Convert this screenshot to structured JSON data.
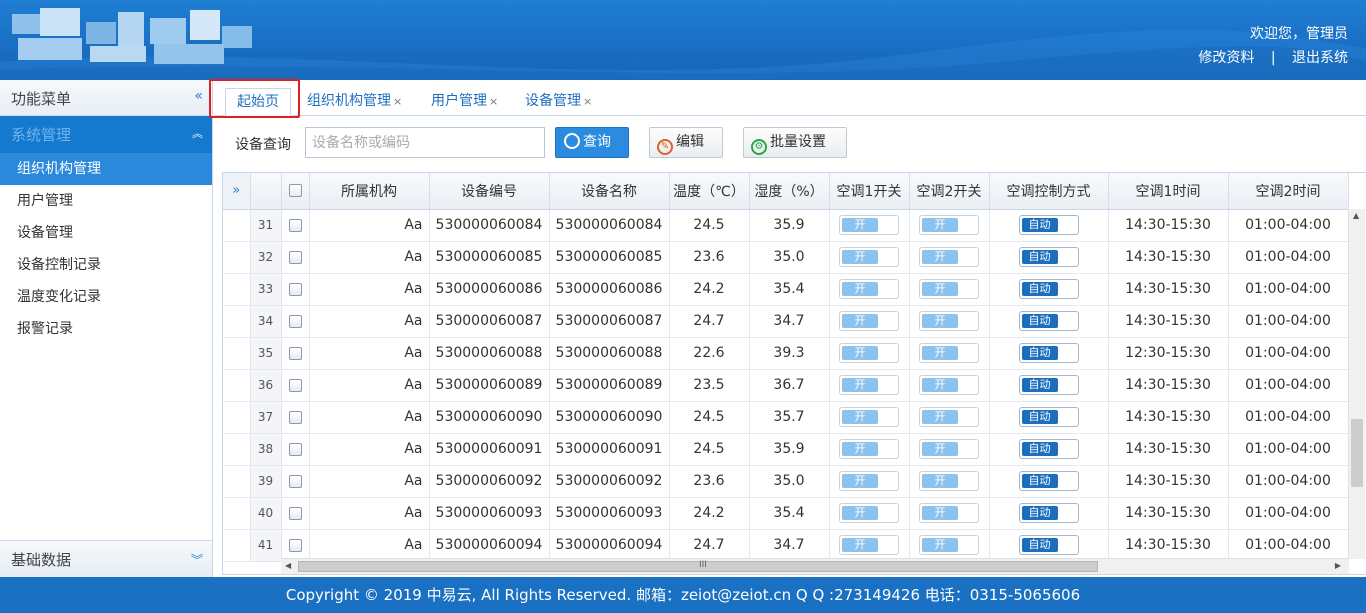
{
  "header": {
    "welcome": "欢迎您，管理员",
    "edit_profile": "修改资料",
    "separator": "|",
    "logout": "退出系统"
  },
  "sidebar": {
    "title": "功能菜单",
    "collapse_icon": "«",
    "group": "系统管理",
    "items": [
      {
        "label": "组织机构管理",
        "active": true
      },
      {
        "label": "用户管理"
      },
      {
        "label": "设备管理"
      },
      {
        "label": "设备控制记录"
      },
      {
        "label": "温度变化记录"
      },
      {
        "label": "报警记录"
      }
    ],
    "footer_group": "基础数据"
  },
  "tabs": [
    {
      "label": "起始页",
      "active": true
    },
    {
      "label": "组织机构管理",
      "close": "×"
    },
    {
      "label": "用户管理",
      "close": "×"
    },
    {
      "label": "设备管理",
      "close": "×"
    }
  ],
  "toolbar": {
    "search_label": "设备查询",
    "search_placeholder": "设备名称或编码",
    "search_value": "",
    "query_button": "查询",
    "edit_button": "编辑",
    "batch_button": "批量设置"
  },
  "grid": {
    "expand_icon": "»",
    "columns": [
      "所属机构",
      "设备编号",
      "设备名称",
      "温度（℃）",
      "湿度（%）",
      "空调1开关",
      "空调2开关",
      "空调控制方式",
      "空调1时间",
      "空调2时间"
    ],
    "switch_on_label": "开",
    "auto_label": "自动",
    "rows": [
      {
        "no": "31",
        "org": "Aa",
        "code": "530000060084",
        "name": "530000060084",
        "temp": "24.5",
        "hum": "35.9",
        "t1": "14:30-15:30",
        "t2": "01:00-04:00"
      },
      {
        "no": "32",
        "org": "Aa",
        "code": "530000060085",
        "name": "530000060085",
        "temp": "23.6",
        "hum": "35.0",
        "t1": "14:30-15:30",
        "t2": "01:00-04:00"
      },
      {
        "no": "33",
        "org": "Aa",
        "code": "530000060086",
        "name": "530000060086",
        "temp": "24.2",
        "hum": "35.4",
        "t1": "14:30-15:30",
        "t2": "01:00-04:00"
      },
      {
        "no": "34",
        "org": "Aa",
        "code": "530000060087",
        "name": "530000060087",
        "temp": "24.7",
        "hum": "34.7",
        "t1": "14:30-15:30",
        "t2": "01:00-04:00"
      },
      {
        "no": "35",
        "org": "Aa",
        "code": "530000060088",
        "name": "530000060088",
        "temp": "22.6",
        "hum": "39.3",
        "t1": "12:30-15:30",
        "t2": "01:00-04:00"
      },
      {
        "no": "36",
        "org": "Aa",
        "code": "530000060089",
        "name": "530000060089",
        "temp": "23.5",
        "hum": "36.7",
        "t1": "14:30-15:30",
        "t2": "01:00-04:00"
      },
      {
        "no": "37",
        "org": "Aa",
        "code": "530000060090",
        "name": "530000060090",
        "temp": "24.5",
        "hum": "35.7",
        "t1": "14:30-15:30",
        "t2": "01:00-04:00"
      },
      {
        "no": "38",
        "org": "Aa",
        "code": "530000060091",
        "name": "530000060091",
        "temp": "24.5",
        "hum": "35.9",
        "t1": "14:30-15:30",
        "t2": "01:00-04:00"
      },
      {
        "no": "39",
        "org": "Aa",
        "code": "530000060092",
        "name": "530000060092",
        "temp": "23.6",
        "hum": "35.0",
        "t1": "14:30-15:30",
        "t2": "01:00-04:00"
      },
      {
        "no": "40",
        "org": "Aa",
        "code": "530000060093",
        "name": "530000060093",
        "temp": "24.2",
        "hum": "35.4",
        "t1": "14:30-15:30",
        "t2": "01:00-04:00"
      },
      {
        "no": "41",
        "org": "Aa",
        "code": "530000060094",
        "name": "530000060094",
        "temp": "24.7",
        "hum": "34.7",
        "t1": "14:30-15:30",
        "t2": "01:00-04:00"
      }
    ]
  },
  "footer": {
    "text": "Copyright © 2019 中易云, All Rights Reserved. 邮箱：zeiot@zeiot.cn Q Q :273149426 电话：0315-5065606"
  },
  "colors": {
    "header_blue": "#1a6fc4",
    "sidebar_active": "#2b89dc",
    "footer_blue": "#1a70c3",
    "highlight_box": "#e02020"
  }
}
